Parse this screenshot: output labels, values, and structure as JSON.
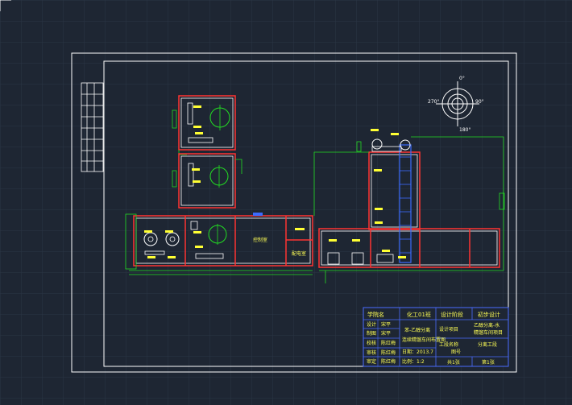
{
  "colors": {
    "background": "#1e2633",
    "grid": "#2b3544",
    "frame": "#ffffff",
    "wall": "#ff3333",
    "pipe": "#22dd22",
    "equipment": "#ffffff",
    "label": "#ffff33",
    "titleblock": "#4a6cff",
    "titletext": "#ffff55"
  },
  "compass": {
    "north": "0°",
    "east": "90°",
    "south": "180°",
    "west": "270°"
  },
  "rooms": {
    "center_room": "控制室",
    "small_room": "配电室"
  },
  "titleblock": {
    "header": [
      "学院名",
      "化工01班",
      "设计阶段",
      "初步设计"
    ],
    "left_rows": [
      [
        "设计",
        "宋平"
      ],
      [
        "制图",
        "宋平"
      ],
      [
        "校核",
        "陈红梅"
      ],
      [
        "审核",
        "陈红梅"
      ],
      [
        "审定",
        "陈红梅"
      ]
    ],
    "drawing_title": "苯-乙醇分离",
    "drawing_subtitle": "连续精馏车间布置图",
    "date": "日期：2013.7",
    "scale": "比例：1:2",
    "project_label": "设计项目",
    "project_value": "乙醇分离-水",
    "project_value2": "精馏车间项目",
    "stage_label": "工段名称",
    "stage_value": "分离工段",
    "drawing_no": "图号",
    "total": "共1张",
    "sheet": "第1张"
  }
}
